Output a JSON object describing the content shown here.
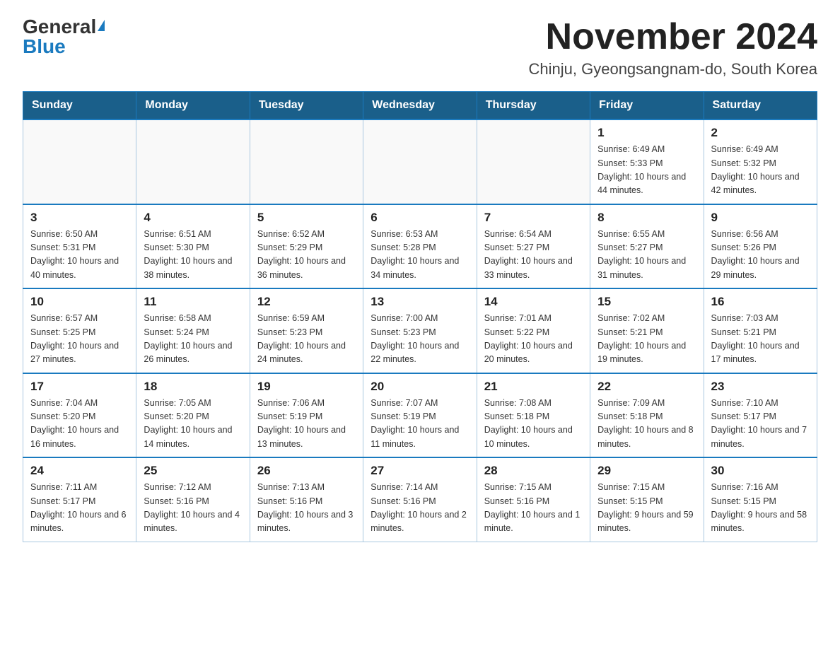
{
  "header": {
    "logo_general": "General",
    "logo_blue": "Blue",
    "month_title": "November 2024",
    "location": "Chinju, Gyeongsangnam-do, South Korea"
  },
  "days_of_week": [
    "Sunday",
    "Monday",
    "Tuesday",
    "Wednesday",
    "Thursday",
    "Friday",
    "Saturday"
  ],
  "weeks": [
    [
      {
        "day": "",
        "info": ""
      },
      {
        "day": "",
        "info": ""
      },
      {
        "day": "",
        "info": ""
      },
      {
        "day": "",
        "info": ""
      },
      {
        "day": "",
        "info": ""
      },
      {
        "day": "1",
        "info": "Sunrise: 6:49 AM\nSunset: 5:33 PM\nDaylight: 10 hours and 44 minutes."
      },
      {
        "day": "2",
        "info": "Sunrise: 6:49 AM\nSunset: 5:32 PM\nDaylight: 10 hours and 42 minutes."
      }
    ],
    [
      {
        "day": "3",
        "info": "Sunrise: 6:50 AM\nSunset: 5:31 PM\nDaylight: 10 hours and 40 minutes."
      },
      {
        "day": "4",
        "info": "Sunrise: 6:51 AM\nSunset: 5:30 PM\nDaylight: 10 hours and 38 minutes."
      },
      {
        "day": "5",
        "info": "Sunrise: 6:52 AM\nSunset: 5:29 PM\nDaylight: 10 hours and 36 minutes."
      },
      {
        "day": "6",
        "info": "Sunrise: 6:53 AM\nSunset: 5:28 PM\nDaylight: 10 hours and 34 minutes."
      },
      {
        "day": "7",
        "info": "Sunrise: 6:54 AM\nSunset: 5:27 PM\nDaylight: 10 hours and 33 minutes."
      },
      {
        "day": "8",
        "info": "Sunrise: 6:55 AM\nSunset: 5:27 PM\nDaylight: 10 hours and 31 minutes."
      },
      {
        "day": "9",
        "info": "Sunrise: 6:56 AM\nSunset: 5:26 PM\nDaylight: 10 hours and 29 minutes."
      }
    ],
    [
      {
        "day": "10",
        "info": "Sunrise: 6:57 AM\nSunset: 5:25 PM\nDaylight: 10 hours and 27 minutes."
      },
      {
        "day": "11",
        "info": "Sunrise: 6:58 AM\nSunset: 5:24 PM\nDaylight: 10 hours and 26 minutes."
      },
      {
        "day": "12",
        "info": "Sunrise: 6:59 AM\nSunset: 5:23 PM\nDaylight: 10 hours and 24 minutes."
      },
      {
        "day": "13",
        "info": "Sunrise: 7:00 AM\nSunset: 5:23 PM\nDaylight: 10 hours and 22 minutes."
      },
      {
        "day": "14",
        "info": "Sunrise: 7:01 AM\nSunset: 5:22 PM\nDaylight: 10 hours and 20 minutes."
      },
      {
        "day": "15",
        "info": "Sunrise: 7:02 AM\nSunset: 5:21 PM\nDaylight: 10 hours and 19 minutes."
      },
      {
        "day": "16",
        "info": "Sunrise: 7:03 AM\nSunset: 5:21 PM\nDaylight: 10 hours and 17 minutes."
      }
    ],
    [
      {
        "day": "17",
        "info": "Sunrise: 7:04 AM\nSunset: 5:20 PM\nDaylight: 10 hours and 16 minutes."
      },
      {
        "day": "18",
        "info": "Sunrise: 7:05 AM\nSunset: 5:20 PM\nDaylight: 10 hours and 14 minutes."
      },
      {
        "day": "19",
        "info": "Sunrise: 7:06 AM\nSunset: 5:19 PM\nDaylight: 10 hours and 13 minutes."
      },
      {
        "day": "20",
        "info": "Sunrise: 7:07 AM\nSunset: 5:19 PM\nDaylight: 10 hours and 11 minutes."
      },
      {
        "day": "21",
        "info": "Sunrise: 7:08 AM\nSunset: 5:18 PM\nDaylight: 10 hours and 10 minutes."
      },
      {
        "day": "22",
        "info": "Sunrise: 7:09 AM\nSunset: 5:18 PM\nDaylight: 10 hours and 8 minutes."
      },
      {
        "day": "23",
        "info": "Sunrise: 7:10 AM\nSunset: 5:17 PM\nDaylight: 10 hours and 7 minutes."
      }
    ],
    [
      {
        "day": "24",
        "info": "Sunrise: 7:11 AM\nSunset: 5:17 PM\nDaylight: 10 hours and 6 minutes."
      },
      {
        "day": "25",
        "info": "Sunrise: 7:12 AM\nSunset: 5:16 PM\nDaylight: 10 hours and 4 minutes."
      },
      {
        "day": "26",
        "info": "Sunrise: 7:13 AM\nSunset: 5:16 PM\nDaylight: 10 hours and 3 minutes."
      },
      {
        "day": "27",
        "info": "Sunrise: 7:14 AM\nSunset: 5:16 PM\nDaylight: 10 hours and 2 minutes."
      },
      {
        "day": "28",
        "info": "Sunrise: 7:15 AM\nSunset: 5:16 PM\nDaylight: 10 hours and 1 minute."
      },
      {
        "day": "29",
        "info": "Sunrise: 7:15 AM\nSunset: 5:15 PM\nDaylight: 9 hours and 59 minutes."
      },
      {
        "day": "30",
        "info": "Sunrise: 7:16 AM\nSunset: 5:15 PM\nDaylight: 9 hours and 58 minutes."
      }
    ]
  ]
}
